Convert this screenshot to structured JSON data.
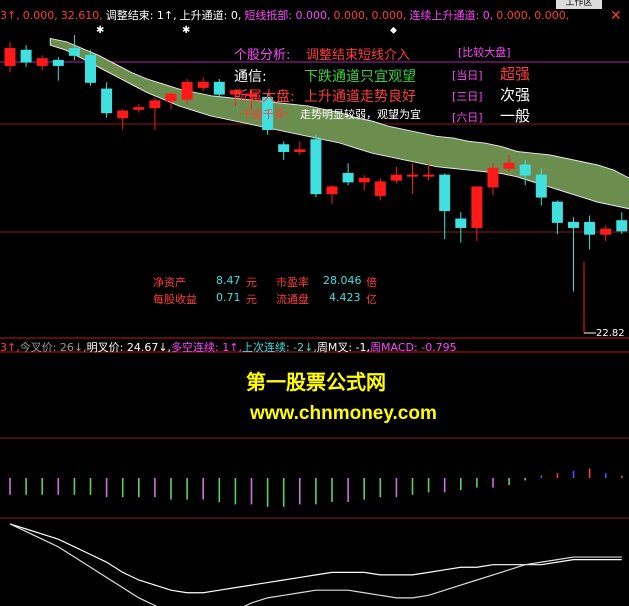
{
  "top_bar": {
    "items": [
      {
        "text": "3↑,",
        "color": "#ff3b3b"
      },
      {
        "text": "0.000,",
        "color": "#ff3b3b"
      },
      {
        "text": "32.610,",
        "color": "#ff3b3b"
      },
      {
        "text": "调整结束: 1↑,",
        "color": "#ffffff"
      },
      {
        "text": "上升通道: 0,",
        "color": "#ffffff"
      },
      {
        "text": "短线抵部: 0.000,",
        "color": "#ff44ff"
      },
      {
        "text": "0.000,",
        "color": "#ff3b3b"
      },
      {
        "text": "0.000,",
        "color": "#ff3b3b"
      },
      {
        "text": "连续上升通道: 0,",
        "color": "#ff44ff"
      },
      {
        "text": "0.000,",
        "color": "#ff3b3b"
      },
      {
        "text": "0.000,",
        "color": "#ff3b3b"
      }
    ],
    "tab_label": "工作区",
    "close_label": "✕"
  },
  "analysis": {
    "title_label": "个股分析:",
    "title_value": "调整结束短线介入",
    "compare_label": "[比较大盘]",
    "channel_label": "通信:",
    "channel_value": "下跌通道只宜观望",
    "market_label": "所属大盘:",
    "market_value": "上升通道走势良好",
    "comment_label": "千股千评:",
    "comment_value": "走势明显较弱，观望为宜",
    "day1_label": "[当日]",
    "day1_value": "超强",
    "day3_label": "[三日]",
    "day3_value": "次强",
    "day6_label": "[六日]",
    "day6_value": "一般"
  },
  "fundamentals": {
    "net_assets_label": "净资产",
    "net_assets_value": "8.47",
    "net_assets_unit": "元",
    "pe_label": "市盈率",
    "pe_value": "28.046",
    "pe_unit": "倍",
    "eps_label": "每股收益",
    "eps_value": "0.71",
    "eps_unit": "元",
    "float_label": "流通盘",
    "float_value": "4.423",
    "float_unit": "亿"
  },
  "price_marker": "22.82",
  "mid_bar": {
    "items": [
      {
        "text": "3↑,",
        "color": "#ff3b3b"
      },
      {
        "text": "今叉价: 26↓,",
        "color": "#9a9a9a"
      },
      {
        "text": "明叉价: 24.67↓,",
        "color": "#ffffff"
      },
      {
        "text": "多空连续: 1↑,",
        "color": "#ff44ff"
      },
      {
        "text": "上次连续: -2↓,",
        "color": "#40e0e0"
      },
      {
        "text": "周M叉: -1,",
        "color": "#ffffff"
      },
      {
        "text": "周MACD: -0.795",
        "color": "#ff44ff"
      }
    ]
  },
  "watermark": {
    "line1": "第一股票公式网",
    "line2": "www.chnmoney.com"
  },
  "colors": {
    "up": "#ff1a1a",
    "down": "#40e0e0",
    "band": "#6b8e4e",
    "grid": "#8b1a1a",
    "divider": "#c01818"
  },
  "chart_data": [
    {
      "type": "candlestick",
      "candles": [
        {
          "o": 64,
          "c": 74,
          "h": 78,
          "l": 60
        },
        {
          "o": 73,
          "c": 66,
          "h": 76,
          "l": 63
        },
        {
          "o": 64,
          "c": 68,
          "h": 70,
          "l": 61
        },
        {
          "o": 67,
          "c": 64,
          "h": 69,
          "l": 55
        },
        {
          "o": 74,
          "c": 70,
          "h": 82,
          "l": 67
        },
        {
          "o": 70,
          "c": 54,
          "h": 73,
          "l": 52
        },
        {
          "o": 50,
          "c": 36,
          "h": 54,
          "l": 33
        },
        {
          "o": 33,
          "c": 37,
          "h": 38,
          "l": 26
        },
        {
          "o": 38,
          "c": 39,
          "h": 41,
          "l": 36
        },
        {
          "o": 39,
          "c": 43,
          "h": 45,
          "l": 26
        },
        {
          "o": 43,
          "c": 47,
          "h": 48,
          "l": 38
        },
        {
          "o": 44,
          "c": 54,
          "h": 56,
          "l": 41
        },
        {
          "o": 51,
          "c": 54,
          "h": 57,
          "l": 49
        },
        {
          "o": 54,
          "c": 47,
          "h": 56,
          "l": 45
        },
        {
          "o": 47,
          "c": 49,
          "h": 50,
          "l": 40
        },
        {
          "o": 46,
          "c": 47,
          "h": 50,
          "l": 38
        },
        {
          "o": 45,
          "c": 26,
          "h": 47,
          "l": 23
        },
        {
          "o": 17,
          "c": 13,
          "h": 19,
          "l": 8
        },
        {
          "o": 13,
          "c": 14,
          "h": 19,
          "l": 11
        },
        {
          "o": 20,
          "c": -12,
          "h": 23,
          "l": -14
        },
        {
          "o": -12,
          "c": -8,
          "h": -7,
          "l": -18
        },
        {
          "o": 0,
          "c": -5,
          "h": 6,
          "l": -7
        },
        {
          "o": -5,
          "c": -3,
          "h": -1,
          "l": -10
        },
        {
          "o": -13,
          "c": -5,
          "h": -3,
          "l": -16
        },
        {
          "o": -4,
          "c": -1,
          "h": 4,
          "l": -6
        },
        {
          "o": -1,
          "c": -1,
          "h": 6,
          "l": -12
        },
        {
          "o": -1,
          "c": -1,
          "h": 6,
          "l": -4
        },
        {
          "o": -1,
          "c": -22,
          "h": 0,
          "l": -39
        },
        {
          "o": -27,
          "c": -32,
          "h": -23,
          "l": -41
        },
        {
          "o": -32,
          "c": -8,
          "h": -8,
          "l": -40
        },
        {
          "o": -8,
          "c": 3,
          "h": 6,
          "l": -13
        },
        {
          "o": 3,
          "c": 6,
          "h": 11,
          "l": 1
        },
        {
          "o": 5,
          "c": -1,
          "h": 8,
          "l": -7
        },
        {
          "o": -1,
          "c": -14,
          "h": 3,
          "l": -19
        },
        {
          "o": -17,
          "c": -29,
          "h": -16,
          "l": -36
        },
        {
          "o": -29,
          "c": -32,
          "h": -26,
          "l": -70
        },
        {
          "o": -29,
          "c": -36,
          "h": -25,
          "l": -45
        },
        {
          "o": -36,
          "c": -33,
          "h": -31,
          "l": -40
        },
        {
          "o": -28,
          "c": -34,
          "h": -23,
          "l": -36
        }
      ],
      "band_upper": [
        80,
        78,
        74,
        70,
        65,
        60,
        56,
        53,
        50,
        48,
        46,
        45,
        44,
        43,
        42,
        41,
        40,
        38,
        36,
        33,
        31,
        28,
        26,
        24,
        22,
        21,
        19,
        18,
        16,
        13,
        12,
        11,
        9,
        7,
        5,
        2,
        -3,
        -7,
        -10
      ],
      "band_lower": [
        76,
        73,
        68,
        63,
        58,
        53,
        48,
        44,
        40,
        37,
        34,
        32,
        30,
        28,
        26,
        24,
        22,
        20,
        18,
        15,
        12,
        10,
        8,
        6,
        4,
        3,
        2,
        1,
        0,
        -2,
        -5,
        -8,
        -11,
        -14,
        -17,
        -19,
        -21,
        -23,
        -25
      ]
    },
    {
      "type": "bar",
      "values": [
        -7,
        -7,
        -7,
        -7,
        -7,
        -7,
        -8,
        -8,
        -8,
        -8,
        -9,
        -9,
        -9,
        -10,
        -11,
        -11,
        -12,
        -12,
        -11,
        -11,
        -10,
        -10,
        -9,
        -8,
        -8,
        -7,
        -6,
        -6,
        -5,
        -4,
        -4,
        -3,
        -1,
        1,
        2,
        3,
        4,
        2,
        1
      ],
      "line1": [
        -18,
        -20,
        -22,
        -24,
        -27,
        -30,
        -33,
        -37,
        -40,
        -42,
        -44,
        -45,
        -45,
        -44,
        -43,
        -42,
        -41,
        -40,
        -39,
        -38,
        -37,
        -37,
        -37,
        -38,
        -38,
        -38,
        -37,
        -36,
        -35,
        -35,
        -34,
        -34,
        -34,
        -34,
        -33,
        -32,
        -32,
        -32,
        -32
      ],
      "line2": [
        -18,
        -21,
        -24,
        -27,
        -31,
        -35,
        -39,
        -43,
        -47,
        -50,
        -53,
        -55,
        -55,
        -54,
        -52,
        -49,
        -47,
        -46,
        -45,
        -44,
        -44,
        -44,
        -45,
        -46,
        -47,
        -47,
        -46,
        -44,
        -42,
        -40,
        -38,
        -36,
        -34,
        -33,
        -32,
        -31,
        -31,
        -31,
        -31
      ]
    }
  ]
}
